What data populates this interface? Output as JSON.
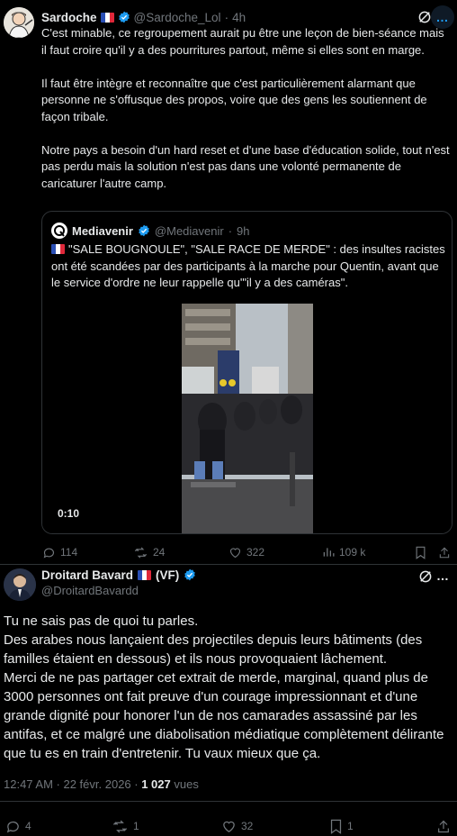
{
  "tweet1": {
    "author_name": "Sardoche",
    "handle": "@Sardoche_Lol",
    "separator": "·",
    "time": "4h",
    "paragraphs": [
      "C'est minable, ce regroupement aurait pu être une leçon de bien-séance mais il faut croire qu'il y a des pourritures partout, même si elles sont en marge.",
      "Il faut être intègre et reconnaître que c'est particulièrement alarmant que personne ne s'offusque des propos, voire que des gens les soutiennent de façon tribale.",
      "Notre pays a besoin d'un hard reset et d'une base d'éducation solide, tout n'est pas perdu mais la solution n'est pas dans une volonté permanente de caricaturer l'autre camp."
    ],
    "more_icon": "…",
    "quote": {
      "author_name": "Mediavenir",
      "handle": "@Mediavenir",
      "separator": "·",
      "time": "9h",
      "text": "\"SALE BOUGNOULE\", \"SALE RACE DE MERDE\" : des insultes racistes ont été scandées par des participants à la marche pour Quentin, avant que le service d'ordre ne leur rappelle qu'\"il y a des caméras\".",
      "video_time": "0:10"
    },
    "stats": {
      "replies": "114",
      "reposts": "24",
      "likes": "322",
      "views": "109 k"
    }
  },
  "tweet2": {
    "author_name": "Droitard Bavard",
    "suffix": "(VF)",
    "handle": "@DroitardBavardd",
    "lines": [
      "Tu ne sais pas de quoi tu parles.",
      "Des arabes nous lançaient des projectiles depuis leurs bâtiments (des familles étaient en dessous) et ils nous provoquaient lâchement.",
      "Merci de ne pas partager cet extrait de merde, marginal, quand plus de 3000 personnes ont fait preuve d'un courage impressionnant et d'une grande dignité pour honorer l'un de nos camarades assassiné par les antifas, et ce malgré une diabolisation médiatique complètement délirante que tu es en train d'entretenir. Tu vaux mieux que ça."
    ],
    "timestamp": "12:47 AM · 22 févr. 2026 ·",
    "views_count": "1 027",
    "views_label": "vues",
    "stats": {
      "replies": "4",
      "reposts": "1",
      "likes": "32",
      "bookmarks": "1"
    }
  },
  "colors": {
    "background": "#000000",
    "text": "#e7e9ea",
    "muted": "#71767b",
    "accent": "#1d9bf0",
    "border": "#2f3336"
  },
  "icons": [
    "french-flag-icon",
    "verified-badge-icon",
    "grok-icon",
    "more-icon",
    "reply-icon",
    "repost-icon",
    "like-icon",
    "views-icon",
    "bookmark-icon",
    "share-icon"
  ]
}
